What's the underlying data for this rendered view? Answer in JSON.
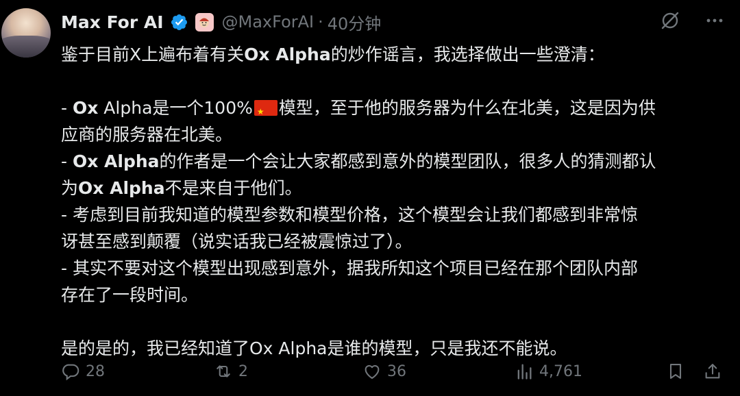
{
  "author": {
    "name": "Max For AI",
    "handle": "@MaxForAI",
    "separator": "·",
    "time": "40分钟"
  },
  "tweet": {
    "lines": [
      "鉴于目前X上遍布着有关Ox Alpha的炒作谣言，我选择做出一些澄清：",
      "",
      "- Ox Alpha是一个100%🇨🇳模型，至于他的服务器为什么在北美，这是因为供",
      "应商的服务器在北美。",
      "- Ox Alpha的作者是一个会让大家都感到意外的模型团队，很多人的猜测都认",
      "为Ox Alpha不是来自于他们。",
      "- 考虑到目前我知道的模型参数和模型价格，这个模型会让我们都感到非常惊",
      "讶甚至感到颠覆（说实话我已经被震惊过了）。",
      "- 其实不要对这个模型出现感到意外，据我所知这个项目已经在那个团队内部",
      "存在了一段时间。",
      "",
      "是的是的，我已经知道了Ox Alpha是谁的模型，只是我还不能说。"
    ],
    "segments": {
      "l1a": "鉴于目前X上遍布着有关",
      "l1b": "Ox Alpha",
      "l1c": "的炒作谣言，我选择做出一些澄清：",
      "l3a": "- ",
      "l3b": "Ox",
      "l3c": " Alpha是一个100%",
      "l3d": "模型，至于他的服务器为什么在北美，这是因为供",
      "l4": "应商的服务器在北美。",
      "l5a": "- ",
      "l5b": "Ox Alpha",
      "l5c": "的作者是一个会让大家都感到意外的模型团队，很多人的猜测都认",
      "l6a": "为",
      "l6b": "Ox Alpha",
      "l6c": "不是来自于他们。",
      "l7": "- 考虑到目前我知道的模型参数和模型价格，这个模型会让我们都感到非常惊",
      "l8": "讶甚至感到颠覆（说实话我已经被震惊过了）。",
      "l9": "- 其实不要对这个模型出现感到意外，据我所知这个项目已经在那个团队内部",
      "l10": "存在了一段时间。",
      "l12": "是的是的，我已经知道了Ox Alpha是谁的模型，只是我还不能说。"
    }
  },
  "actions": {
    "replies": "28",
    "reposts": "2",
    "likes": "36",
    "views": "4,761"
  },
  "icons": {
    "verified": "verified-badge-icon",
    "affiliate": "affiliate-avatar-badge-icon",
    "grok": "grok-icon",
    "more": "more-dots-icon",
    "reply": "reply-icon",
    "repost": "repost-icon",
    "like": "like-icon",
    "views": "views-icon",
    "bookmark": "bookmark-icon",
    "share": "share-icon"
  },
  "colors": {
    "background": "#000000",
    "text": "#e7e9ea",
    "muted": "#71767b",
    "verified": "#1d9bf0"
  }
}
